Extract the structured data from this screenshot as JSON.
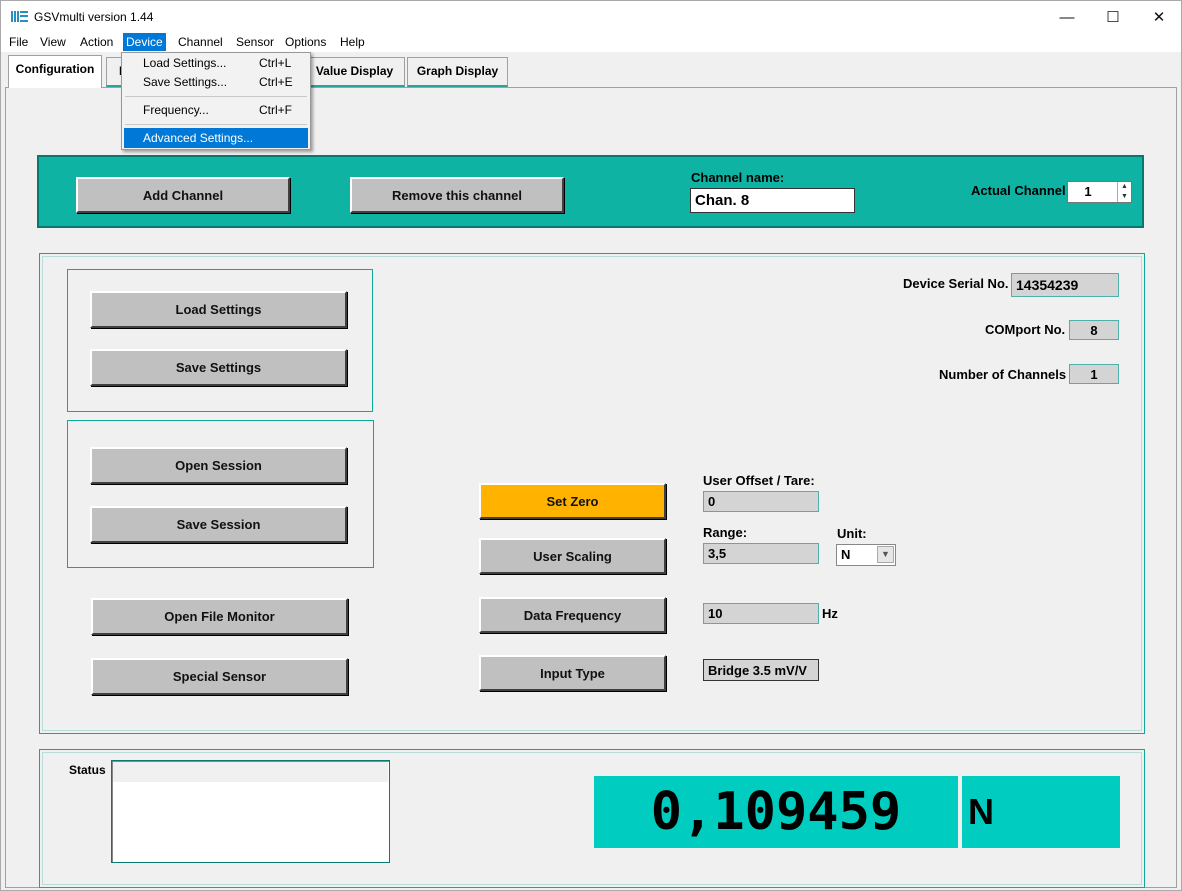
{
  "window": {
    "title": "GSVmulti version 1.44"
  },
  "menubar": [
    "File",
    "View",
    "Action",
    "Device",
    "Channel",
    "Sensor",
    "Options",
    "Help"
  ],
  "device_menu": {
    "items": [
      {
        "label": "Load Settings...",
        "shortcut": "Ctrl+L"
      },
      {
        "label": "Save Settings...",
        "shortcut": "Ctrl+E"
      },
      {
        "label": "Frequency...",
        "shortcut": "Ctrl+F"
      },
      {
        "label": "Advanced Settings...",
        "shortcut": ""
      }
    ]
  },
  "tabs": [
    "Configuration",
    "F",
    "Value Display",
    "Graph Display"
  ],
  "channel_bar": {
    "add_channel": "Add Channel",
    "remove_channel": "Remove this channel",
    "channel_name_label": "Channel name:",
    "channel_name_value": "Chan. 8",
    "actual_channel_label": "Actual Channel",
    "actual_channel_value": "1"
  },
  "settings_box": {
    "load_settings": "Load Settings",
    "save_settings": "Save Settings"
  },
  "session_box": {
    "open_session": "Open Session",
    "save_session": "Save Session"
  },
  "misc_buttons": {
    "open_file_monitor": "Open File Monitor",
    "special_sensor": "Special Sensor"
  },
  "device_info": {
    "serial_label": "Device Serial No.",
    "serial_value": "14354239",
    "comport_label": "COMport No.",
    "comport_value": "8",
    "channels_label": "Number of Channels",
    "channels_value": "1"
  },
  "measurement": {
    "set_zero": "Set Zero",
    "user_scaling": "User Scaling",
    "data_frequency": "Data Frequency",
    "input_type": "Input Type",
    "offset_label": "User Offset / Tare:",
    "offset_value": "0",
    "range_label": "Range:",
    "range_value": "3,5",
    "unit_label": "Unit:",
    "unit_value": "N",
    "frequency_value": "10",
    "frequency_unit": "Hz",
    "input_type_value": "Bridge 3.5 mV/V"
  },
  "status": {
    "label": "Status",
    "display_value": "0,109459",
    "display_unit": "N"
  },
  "colors": {
    "teal": "#0fb3a4",
    "display_teal": "#00cdc0",
    "orange": "#ffb300",
    "menu_highlight": "#0078d7"
  }
}
